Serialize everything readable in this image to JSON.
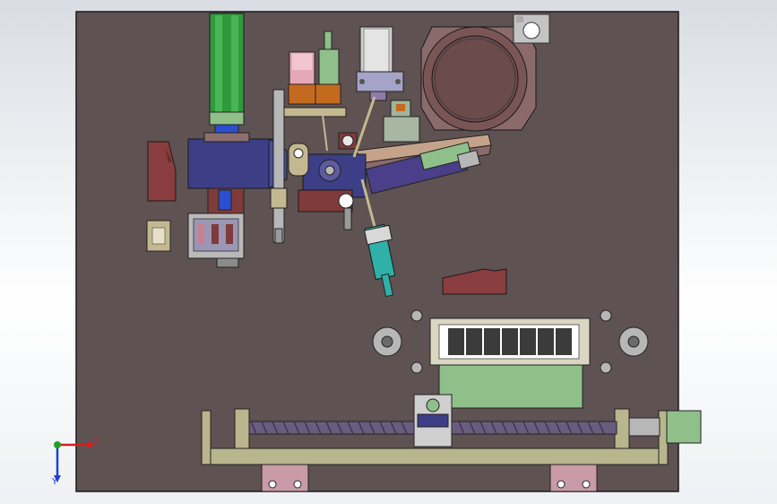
{
  "viewport": {
    "background_top": "#d9dde3",
    "background_bottom": "#ffffff",
    "plate_color": "#5e5352",
    "outline_color": "#1a1a1a"
  },
  "triad": {
    "x_label": "X",
    "y_label": "Y",
    "x_color": "#d21f1f",
    "y_color": "#1f3fd2",
    "z_color": "#1fa31f"
  },
  "colors": {
    "green_cylinder": "#2f9a3c",
    "blue_block": "#3c3f86",
    "pink_part": "#c97f92",
    "orange_part": "#c46a1e",
    "maroon_part": "#7f3b3a",
    "light_green": "#8fc08a",
    "olive_frame": "#b9b58c",
    "teal_motor": "#2fb0a8",
    "grey_metal": "#b7b7b7",
    "bowl": "#7a5556",
    "screw": "#6a5c7f"
  }
}
